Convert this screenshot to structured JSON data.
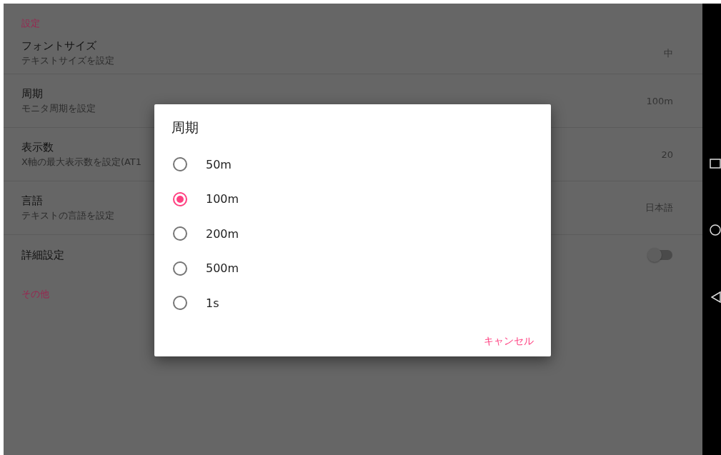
{
  "settings_header": "設定",
  "rows": [
    {
      "kind": "value",
      "title": "フォントサイズ",
      "subtitle": "テキストサイズを設定",
      "value": "中"
    },
    {
      "kind": "value",
      "title": "周期",
      "subtitle": "モニタ周期を設定",
      "value": "100m"
    },
    {
      "kind": "value",
      "title": "表示数",
      "subtitle": "X軸の最大表示数を設定(AT1",
      "value": "20"
    },
    {
      "kind": "value",
      "title": "言語",
      "subtitle": "テキストの言語を設定",
      "value": "日本語"
    },
    {
      "kind": "toggle",
      "title": "詳細設定",
      "on": false
    }
  ],
  "other_header": "その他",
  "dialog": {
    "title": "周期",
    "options": [
      {
        "label": "50m",
        "selected": false
      },
      {
        "label": "100m",
        "selected": true
      },
      {
        "label": "200m",
        "selected": false
      },
      {
        "label": "500m",
        "selected": false
      },
      {
        "label": "1s",
        "selected": false
      }
    ],
    "cancel": "キャンセル"
  }
}
